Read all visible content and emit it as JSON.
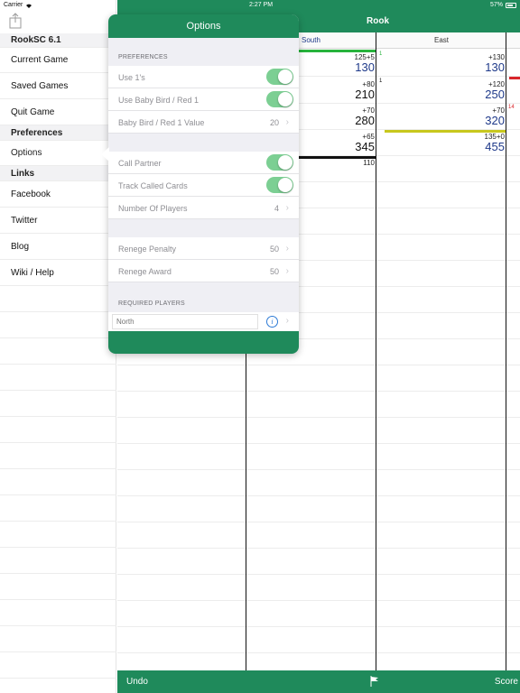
{
  "status_bar": {
    "carrier": "Carrier",
    "time": "2:27 PM",
    "battery": "57%"
  },
  "sidebar": {
    "app_version": "RookSC 6.1",
    "items": [
      {
        "label": "Current Game"
      },
      {
        "label": "Saved Games"
      },
      {
        "label": "Quit Game"
      }
    ],
    "preferences_header": "Preferences",
    "options_label": "Options",
    "links_header": "Links",
    "links": [
      {
        "label": "Facebook"
      },
      {
        "label": "Twitter"
      },
      {
        "label": "Blog"
      },
      {
        "label": "Wiki / Help"
      }
    ]
  },
  "main": {
    "title": "Rook",
    "columns": [
      "South",
      "East"
    ],
    "south": [
      {
        "small": "125+5",
        "big": "130"
      },
      {
        "small": "+80",
        "big": "210"
      },
      {
        "small": "+70",
        "big": "280"
      },
      {
        "small": "+65",
        "big": "345"
      },
      {
        "small": "110",
        "big": ""
      }
    ],
    "east": [
      {
        "small": "+130",
        "big": "130"
      },
      {
        "small": "+120",
        "big": "250"
      },
      {
        "small": "+70",
        "big": "320"
      },
      {
        "small": "135+0",
        "big": "455"
      }
    ],
    "markers": {
      "south_1": "1",
      "south_2": "1",
      "east_3": "14"
    },
    "colors": {
      "green": "#1f8a5b",
      "score_blue": "#1f3a8a",
      "bar_green": "#27b33c",
      "bar_red": "#d9262b",
      "bar_yellow": "#c7c71e",
      "bar_black": "#111111"
    }
  },
  "tabbar": {
    "undo": "Undo",
    "score": "Score"
  },
  "popover": {
    "title": "Options",
    "preferences_title": "PREFERENCES",
    "use_ones": "Use 1's",
    "use_baby_bird": "Use Baby Bird / Red 1",
    "baby_bird_value_label": "Baby Bird / Red 1 Value",
    "baby_bird_value": "20",
    "call_partner": "Call Partner",
    "track_called_cards": "Track Called Cards",
    "number_of_players_label": "Number Of Players",
    "number_of_players": "4",
    "renege_penalty_label": "Renege Penalty",
    "renege_penalty": "50",
    "renege_award_label": "Renege Award",
    "renege_award": "50",
    "required_players_title": "REQUIRED PLAYERS",
    "required_players_placeholder": "North",
    "info_glyph": "i",
    "chevron": "›",
    "toggles": {
      "use_ones": true,
      "use_baby_bird": true,
      "call_partner": true,
      "track_called_cards": true
    }
  }
}
